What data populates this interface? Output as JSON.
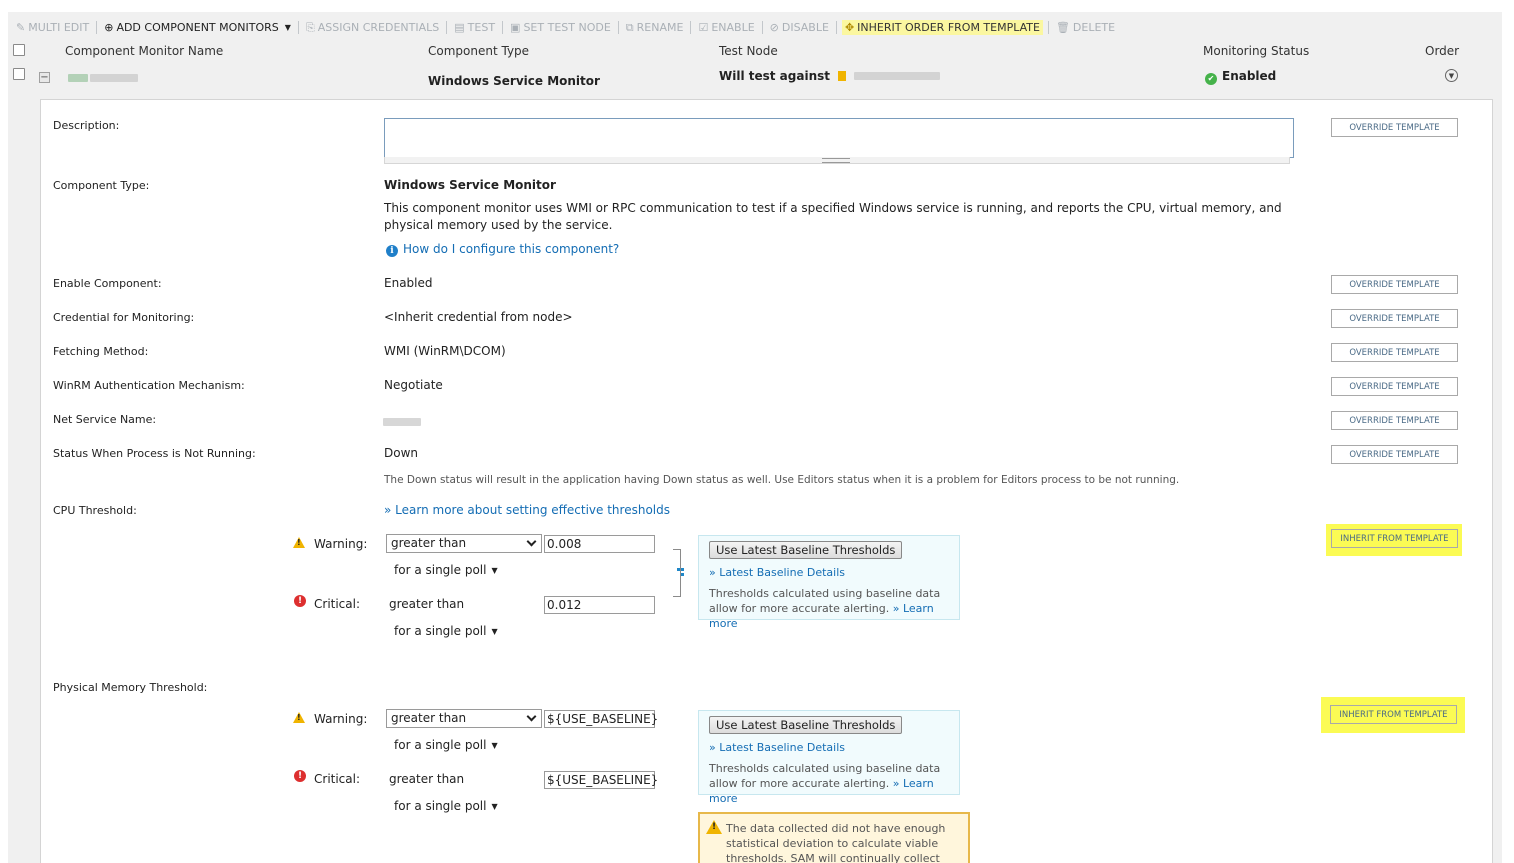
{
  "toolbar": {
    "multi_edit": "MULTI EDIT",
    "add_component_monitors": "ADD COMPONENT MONITORS",
    "assign_credentials": "ASSIGN CREDENTIALS",
    "test": "TEST",
    "set_test_node": "SET TEST NODE",
    "rename": "RENAME",
    "enable": "ENABLE",
    "disable": "DISABLE",
    "inherit_order": "INHERIT ORDER FROM TEMPLATE",
    "delete": "DELETE"
  },
  "table_header": {
    "name": "Component Monitor Name",
    "type": "Component Type",
    "test_node": "Test Node",
    "status": "Monitoring Status",
    "order": "Order"
  },
  "row": {
    "type": "Windows Service Monitor",
    "test_node_prefix": "Will test against",
    "status": "Enabled"
  },
  "labels": {
    "description": "Description:",
    "component_type": "Component Type:",
    "enable_component": "Enable Component:",
    "credential": "Credential for Monitoring:",
    "fetching_method": "Fetching Method:",
    "winrm_auth": "WinRM Authentication Mechanism:",
    "net_service_name": "Net Service Name:",
    "status_not_running": "Status When Process is Not Running:",
    "cpu_threshold": "CPU Threshold:",
    "physical_memory_threshold": "Physical Memory Threshold:"
  },
  "values": {
    "component_type_name": "Windows Service Monitor",
    "component_type_desc": "This component monitor uses WMI or RPC communication to test if a specified Windows service is running, and reports the CPU, virtual memory, and physical memory used by the service.",
    "how_configure": "How do I configure this component?",
    "enable_component": "Enabled",
    "credential": "<Inherit credential from node>",
    "fetching_method": "WMI (WinRM\\DCOM)",
    "winrm_auth": "Negotiate",
    "status_not_running": "Down",
    "status_note": "The Down status will result in the application having Down status as well. Use Editors status when it is a problem for Editors process to be not running.",
    "learn_thresholds": "» Learn more about setting effective thresholds"
  },
  "buttons": {
    "override": "OVERRIDE TEMPLATE",
    "inherit": "INHERIT FROM TEMPLATE"
  },
  "thresholds": {
    "warning_label": "Warning:",
    "critical_label": "Critical:",
    "operator": "greater than",
    "poll": "for a single poll",
    "cpu": {
      "warning": "0.008",
      "critical": "0.012"
    },
    "memory": {
      "warning": "${USE_BASELINE}",
      "critical": "${USE_BASELINE}"
    }
  },
  "baseline": {
    "button": "Use Latest Baseline Thresholds",
    "details_link": "» Latest Baseline Details",
    "text": "Thresholds calculated using baseline data allow for more accurate alerting.",
    "learn_more": "» Learn more"
  },
  "warning_message": "The data collected did not have enough statistical deviation to calculate viable thresholds. SAM will continually collect data"
}
